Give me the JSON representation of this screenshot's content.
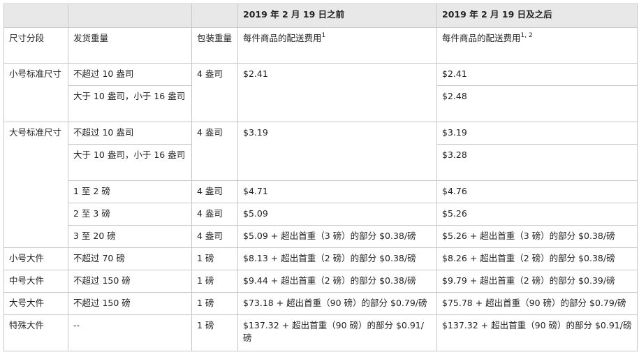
{
  "table": {
    "group_headers": [
      "",
      "",
      "",
      "2019 年 2 月 19 日之前",
      "2019 年 2 月 19 日及之后"
    ],
    "column_headers": {
      "size_tier": "尺寸分段",
      "shipping_weight": "发货重量",
      "packaging_weight": "包装重量",
      "fee_before": "每件商品的配送费用",
      "fee_before_sup": "1",
      "fee_after": "每件商品的配送费用",
      "fee_after_sup": "1, 2"
    },
    "rows": [
      {
        "tier": "小号标准尺寸",
        "weight": "不超过 10 盎司",
        "packaging": "4 盎司",
        "before": "$2.41",
        "after": "$2.41"
      },
      {
        "weight": "大于 10 盎司，小于 16 盎司",
        "after": "$2.48"
      },
      {
        "tier": "大号标准尺寸",
        "weight": "不超过 10 盎司",
        "packaging": "4 盎司",
        "before": "$3.19",
        "after": "$3.19"
      },
      {
        "weight": "大于 10 盎司，小于 16 盎司",
        "after": "$3.28"
      },
      {
        "weight": "1 至 2 磅",
        "packaging": "4 盎司",
        "before": "$4.71",
        "after": "$4.76"
      },
      {
        "weight": "2 至 3 磅",
        "packaging": "4 盎司",
        "before": "$5.09",
        "after": "$5.26"
      },
      {
        "weight": "3 至 20 磅",
        "packaging": "4 盎司",
        "before": "$5.09 + 超出首重（3 磅）的部分 $0.38/磅",
        "after": "$5.26 + 超出首重（3 磅）的部分 $0.38/磅"
      },
      {
        "tier": "小号大件",
        "weight": "不超过 70 磅",
        "packaging": "1 磅",
        "before": "$8.13 + 超出首重（2 磅）的部分 $0.38/磅",
        "after": "$8.26 + 超出首重（2 磅）的部分 $0.38/磅"
      },
      {
        "tier": "中号大件",
        "weight": "不超过 150 磅",
        "packaging": "1 磅",
        "before": "$9.44 + 超出首重（2 磅）的部分 $0.38/磅",
        "after": "$9.79 + 超出首重（2 磅）的部分 $0.39/磅"
      },
      {
        "tier": "大号大件",
        "weight": "不超过 150 磅",
        "packaging": "1 磅",
        "before": "$73.18 + 超出首重（90 磅）的部分 $0.79/磅",
        "after": "$75.78 + 超出首重（90 磅）的部分 $0.79/磅"
      },
      {
        "tier": "特殊大件",
        "weight": "--",
        "packaging": "1 磅",
        "before": "$137.32 + 超出首重（90 磅）的部分 $0.91/磅",
        "after": "$137.32 + 超出首重（90 磅）的部分 $0.91/磅"
      }
    ]
  }
}
